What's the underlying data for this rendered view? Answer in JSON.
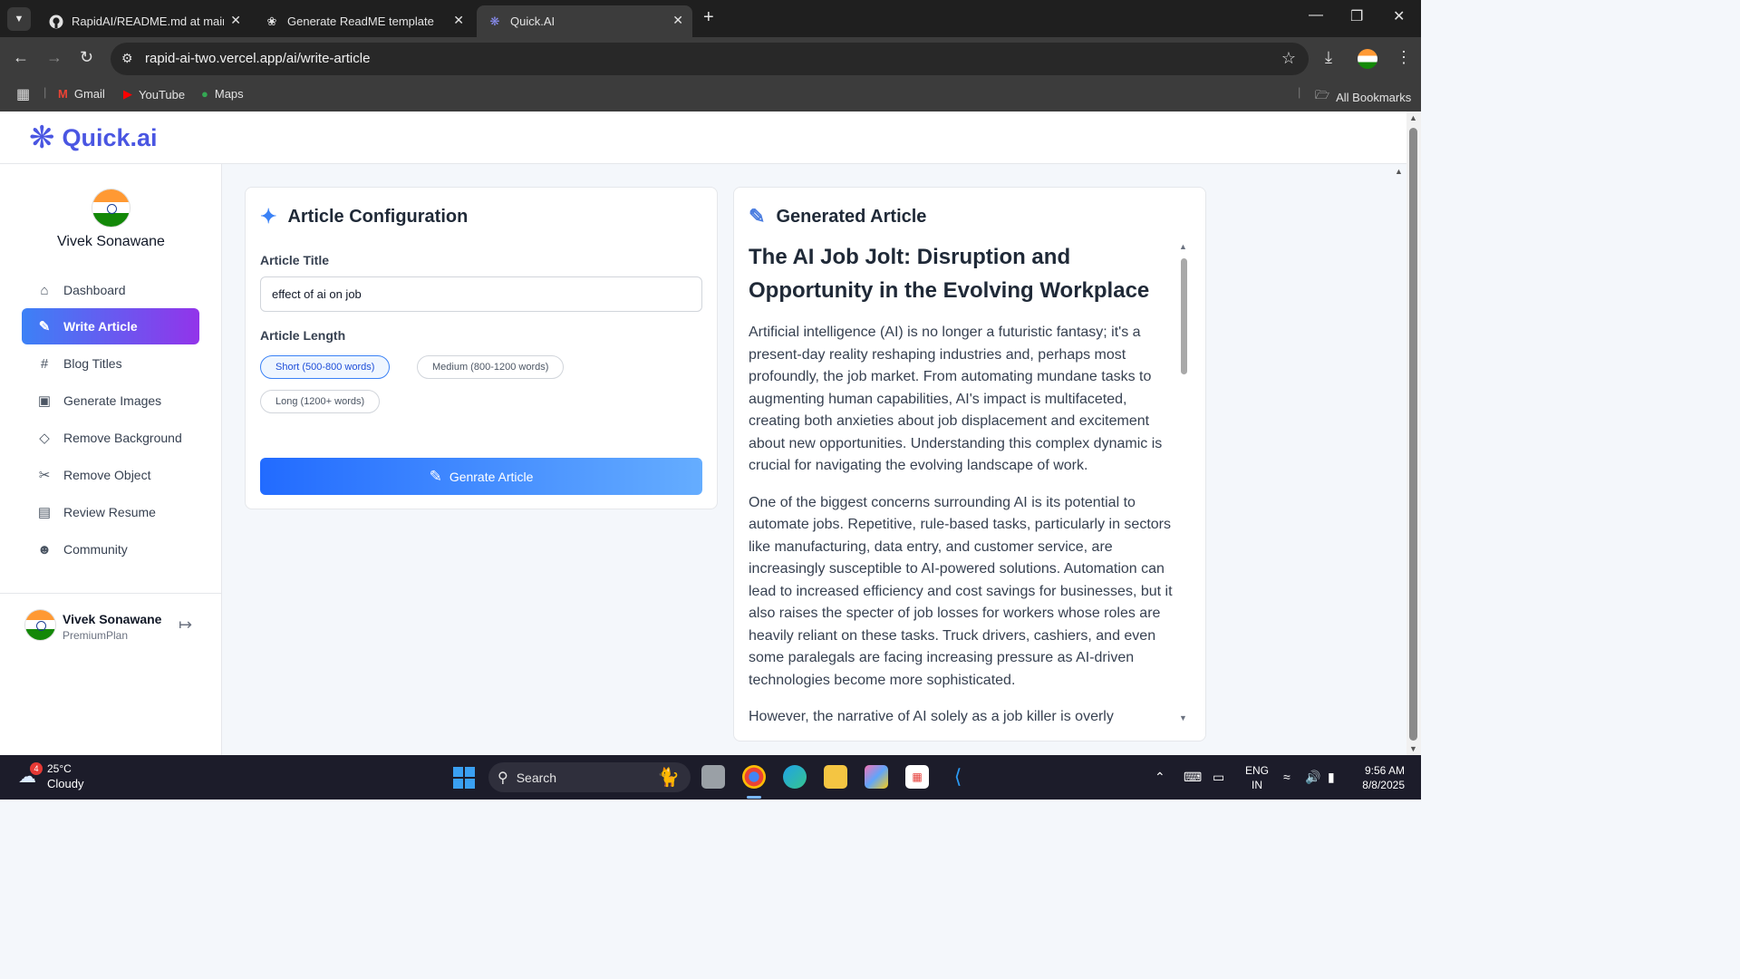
{
  "browser": {
    "tabs": [
      {
        "title": "RapidAI/README.md at main · ",
        "icon": "github-icon"
      },
      {
        "title": "Generate ReadME template",
        "icon": "chatgpt-icon"
      },
      {
        "title": "Quick.AI",
        "icon": "quickai-icon"
      }
    ],
    "active_tab": 2,
    "url": "rapid-ai-two.vercel.app/ai/write-article",
    "bookmarks": [
      {
        "label": "Gmail",
        "icon": "gmail-icon"
      },
      {
        "label": "YouTube",
        "icon": "youtube-icon"
      },
      {
        "label": "Maps",
        "icon": "maps-icon"
      }
    ],
    "all_bookmarks": "All Bookmarks"
  },
  "app": {
    "brand": "Quick.ai",
    "brand_color": "#4a56e2",
    "user": {
      "name": "Vivek Sonawane",
      "plan": "PremiumPlan"
    },
    "nav": [
      {
        "label": "Dashboard",
        "icon": "home-icon",
        "active": false
      },
      {
        "label": "Write Article",
        "icon": "edit-icon",
        "active": true
      },
      {
        "label": "Blog Titles",
        "icon": "hash-icon",
        "active": false
      },
      {
        "label": "Generate Images",
        "icon": "image-icon",
        "active": false
      },
      {
        "label": "Remove Background",
        "icon": "eraser-icon",
        "active": false
      },
      {
        "label": "Remove Object",
        "icon": "scissors-icon",
        "active": false
      },
      {
        "label": "Review Resume",
        "icon": "file-text-icon",
        "active": false
      },
      {
        "label": "Community",
        "icon": "users-icon",
        "active": false
      }
    ],
    "config": {
      "title": "Article Configuration",
      "article_title_label": "Article Title",
      "article_title_value": "effect of ai on job",
      "length_label": "Article Length",
      "lengths": [
        {
          "label": "Short (500-800 words)",
          "selected": true
        },
        {
          "label": "Medium (800-1200 words)",
          "selected": false
        },
        {
          "label": "Long (1200+ words)",
          "selected": false
        }
      ],
      "button": "Genrate Article"
    },
    "generated": {
      "title": "Generated Article",
      "heading": "The AI Job Jolt: Disruption and Opportunity in the Evolving Workplace",
      "paragraphs": [
        "Artificial intelligence (AI) is no longer a futuristic fantasy; it's a present-day reality reshaping industries and, perhaps most profoundly, the job market. From automating mundane tasks to augmenting human capabilities, AI's impact is multifaceted, creating both anxieties about job displacement and excitement about new opportunities. Understanding this complex dynamic is crucial for navigating the evolving landscape of work.",
        "One of the biggest concerns surrounding AI is its potential to automate jobs. Repetitive, rule-based tasks, particularly in sectors like manufacturing, data entry, and customer service, are increasingly susceptible to AI-powered solutions. Automation can lead to increased efficiency and cost savings for businesses, but it also raises the specter of job losses for workers whose roles are heavily reliant on these tasks. Truck drivers, cashiers, and even some paralegals are facing increasing pressure as AI-driven technologies become more sophisticated.",
        "However, the narrative of AI solely as a job killer is overly"
      ]
    }
  },
  "taskbar": {
    "temp": "25°C",
    "condition": "Cloudy",
    "badge": "4",
    "search": "Search",
    "lang_1": "ENG",
    "lang_2": "IN",
    "time": "9:56 AM",
    "date": "8/8/2025"
  }
}
